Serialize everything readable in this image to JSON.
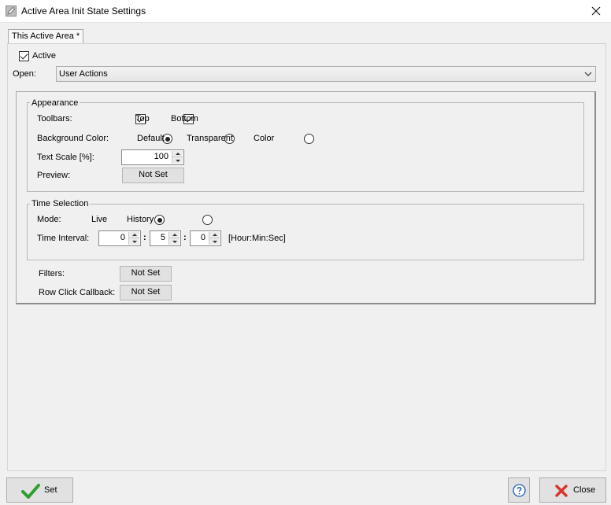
{
  "window": {
    "title": "Active Area Init State Settings",
    "icon": "pencil-icon"
  },
  "tab": {
    "label": "This Active Area *"
  },
  "active": {
    "label": "Active",
    "checked": true
  },
  "open": {
    "label": "Open:",
    "value": "User Actions"
  },
  "appearance": {
    "title": "Appearance",
    "toolbars": {
      "label": "Toolbars:",
      "top": "Top",
      "bottom": "Bottom",
      "top_checked": true,
      "bottom_checked": true
    },
    "background": {
      "label": "Background Color:",
      "options": [
        "Default",
        "Transparent",
        "Color"
      ],
      "selected": "Default"
    },
    "text_scale": {
      "label": "Text Scale [%]:",
      "value": "100"
    },
    "preview": {
      "label": "Preview:",
      "button": "Not Set"
    }
  },
  "time_selection": {
    "title": "Time Selection",
    "mode": {
      "label": "Mode:",
      "options": [
        "Live",
        "History"
      ],
      "selected": "Live"
    },
    "interval": {
      "label": "Time Interval:",
      "hours": "0",
      "minutes": "5",
      "seconds": "0",
      "separator": ":",
      "unit": "[Hour:Min:Sec]"
    }
  },
  "filters": {
    "label": "Filters:",
    "button": "Not Set"
  },
  "row_click": {
    "label": "Row Click Callback:",
    "button": "Not Set"
  },
  "footer": {
    "set_label": "Set",
    "close_label": "Close",
    "help_icon": "help-icon",
    "close_icon": "close-icon",
    "check_icon": "check-icon"
  },
  "colors": {
    "check_green": "#2f9e2f",
    "close_red": "#d9342b",
    "help_blue": "#1a5fb4"
  }
}
